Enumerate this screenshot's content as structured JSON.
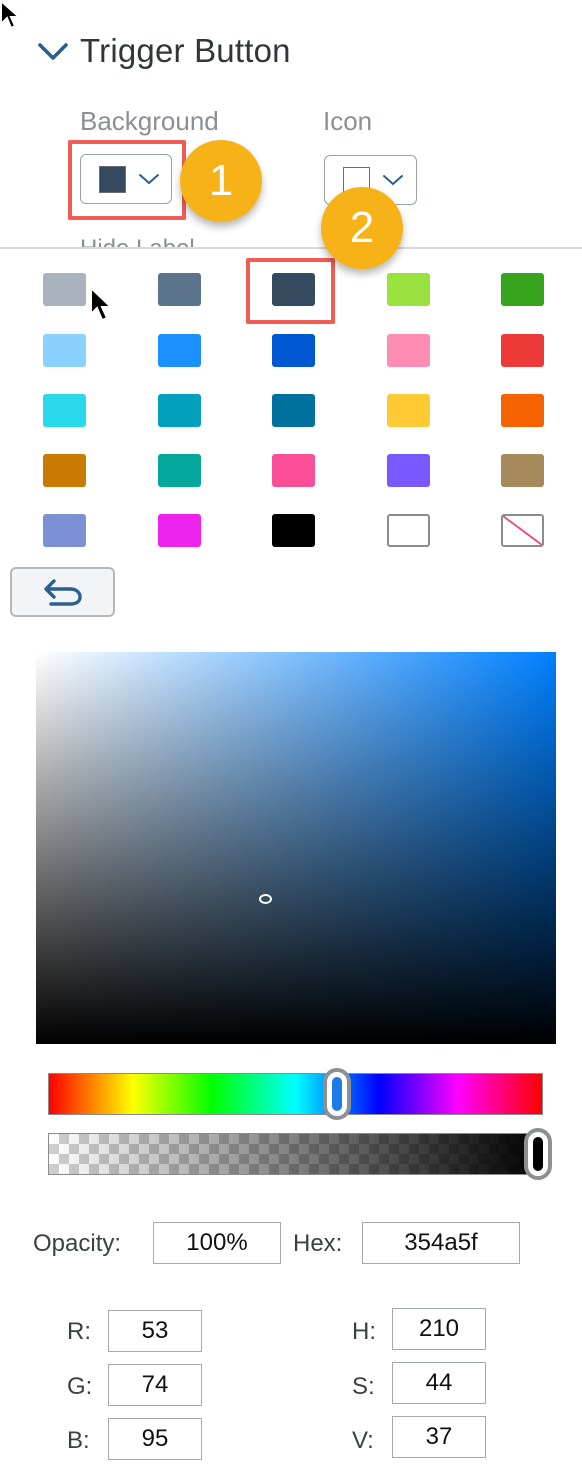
{
  "section": {
    "title": "Trigger Button",
    "icon": "chevron-down-icon"
  },
  "fields": {
    "background": {
      "label": "Background",
      "swatch_color": "#354a5f",
      "icon": "chevron-down-icon"
    },
    "icon": {
      "label": "Icon",
      "swatch_color": "#ffffff",
      "icon": "chevron-down-icon"
    },
    "hidden_label": "Hide Label"
  },
  "callouts": [
    {
      "number": "1",
      "color": "#f7b218"
    },
    {
      "number": "2",
      "color": "#f7b218"
    }
  ],
  "highlight_color": "#f25c54",
  "palette": {
    "selected_index": 2,
    "colors": [
      "#a8b3bd",
      "#5b738b",
      "#354a5f",
      "#98e13e",
      "#36a41d",
      "#89d1ff",
      "#1b90ff",
      "#0057d2",
      "#ff8cb2",
      "#ee3939",
      "#2ad8ec",
      "#049fbe",
      "#00709e",
      "#ffc933",
      "#f56300",
      "#c87b00",
      "#05a79d",
      "#fa4f96",
      "#7858ff",
      "#a68a5b",
      "#7b91d4",
      "#ee24ee",
      "#000000",
      "#ffffff",
      "none"
    ]
  },
  "undo": {
    "icon": "undo-arrow-icon"
  },
  "picker": {
    "hue": 210,
    "hue_fraction": 0.5833,
    "saturation_fraction": 0.44,
    "value_fraction": 0.37,
    "opacity_fraction": 1.0,
    "current_color": "#354a5f"
  },
  "values": {
    "opacity_label": "Opacity:",
    "opacity": "100%",
    "hex_label": "Hex:",
    "hex": "354a5f",
    "r_label": "R:",
    "r": "53",
    "g_label": "G:",
    "g": "74",
    "b_label": "B:",
    "b": "95",
    "h_label": "H:",
    "h": "210",
    "s_label": "S:",
    "s": "44",
    "v_label": "V:",
    "v": "37"
  }
}
